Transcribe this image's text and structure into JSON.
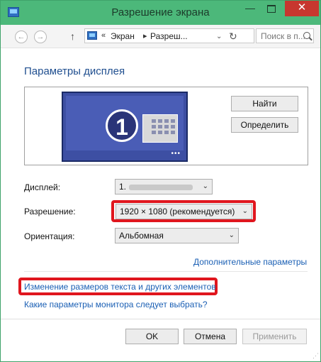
{
  "window": {
    "title": "Разрешение экрана",
    "minimize_glyph": "—",
    "close_glyph": "✕"
  },
  "navbar": {
    "back_glyph": "←",
    "forward_glyph": "→",
    "up_glyph": "↑",
    "address_separator": "«",
    "breadcrumb": [
      "Экран",
      "Разреш..."
    ],
    "breadcrumb_arrow": "▸",
    "address_dropdown_glyph": "⌄",
    "refresh_glyph": "↻",
    "search_placeholder": "Поиск в п..."
  },
  "main": {
    "heading": "Параметры дисплея",
    "find_button": "Найти",
    "identify_button": "Определить",
    "monitor_number": "1",
    "monitor_dots": "•••",
    "display_label": "Дисплей:",
    "display_value": "1.",
    "resolution_label": "Разрешение:",
    "resolution_value": "1920 × 1080 (рекомендуется)",
    "orientation_label": "Ориентация:",
    "orientation_value": "Альбомная",
    "dropdown_arrow": "⌄",
    "advanced_link": "Дополнительные параметры",
    "text_size_link": "Изменение размеров текста и других элементов",
    "monitor_help_link": "Какие параметры монитора следует выбрать?"
  },
  "footer": {
    "ok": "OK",
    "cancel": "Отмена",
    "apply": "Применить",
    "resize_grip": "⋰"
  },
  "colors": {
    "titlebar": "#4cb87a",
    "close_button": "#c7372f",
    "heading": "#1f4e8f",
    "link": "#1a5fb4",
    "highlight": "#e0161e",
    "monitor": "#3d4fa3"
  },
  "icons": [
    "window-icon",
    "back-icon",
    "forward-icon",
    "up-icon",
    "address-icon",
    "refresh-icon",
    "search-icon",
    "monitor-icon"
  ]
}
